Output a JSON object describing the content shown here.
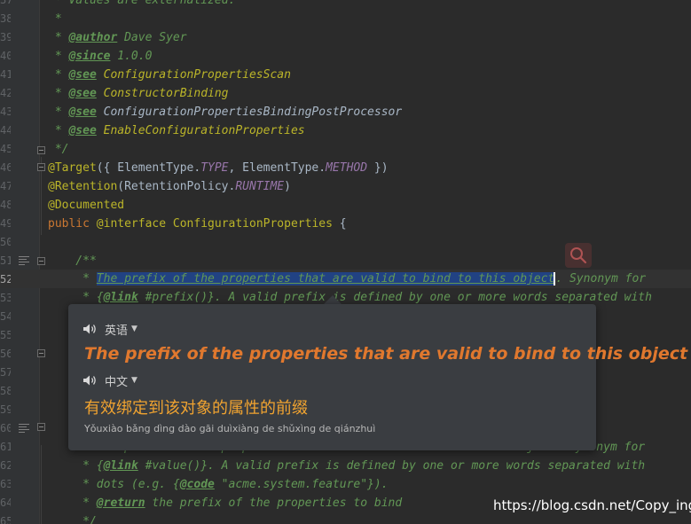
{
  "gutter": {
    "line_numbers": [
      "37",
      "38",
      "39",
      "40",
      "41",
      "42",
      "43",
      "44",
      "45",
      "46",
      "47",
      "48",
      "49",
      "50",
      "51",
      "52",
      "53",
      "54",
      "55",
      "56",
      "57",
      "58",
      "59",
      "60",
      "61",
      "62",
      "63",
      "64",
      "65"
    ],
    "current_line": "52"
  },
  "code": {
    "l37": " * Values are externalized.",
    "l38": " *",
    "l39_tag": "@author",
    "l39_rest": " Dave Syer",
    "l40_tag": "@since",
    "l40_rest": " 1.0.0",
    "l41_tag": "@see",
    "l41_rest": "ConfigurationPropertiesScan",
    "l42_tag": "@see",
    "l42_rest": "ConstructorBinding",
    "l43_tag": "@see",
    "l43_rest": " ConfigurationPropertiesBindingPostProcessor",
    "l44_tag": "@see",
    "l44_rest": "EnableConfigurationProperties",
    "l45": " */",
    "l46_ann": "@Target",
    "l46_a": "({ ElementType.",
    "l46_c1": "TYPE",
    "l46_b": ", ElementType.",
    "l46_c2": "METHOD",
    "l46_end": " })",
    "l47_ann": "@Retention",
    "l47_a": "(RetentionPolicy.",
    "l47_c": "RUNTIME",
    "l47_end": ")",
    "l48_ann": "@Documented",
    "l49_kw": "public",
    "l49_ann": "@interface",
    "l49_name": "ConfigurationProperties",
    "l49_end": " {",
    "l51": "    /**",
    "l52_pre": "     * ",
    "l52_sel": "The prefix of the properties that are valid to bind to this object",
    "l52_post": ". Synonym for",
    "l53_pre": "     * {",
    "l53_tag": "@link",
    "l53_post": " #prefix()}. A valid prefix is defined by one or more words separated with",
    "l61": "     * The prefix of the properties that are valid to bind to this object. Synonym for",
    "l62_pre": "     * {",
    "l62_tag": "@link",
    "l62_post": " #value()}. A valid prefix is defined by one or more words separated with",
    "l63_pre": "     * dots (e.g. {",
    "l63_tag": "@code",
    "l63_post": " \"acme.system.feature\"}).",
    "l64_pre": "     * ",
    "l64_tag": "@return",
    "l64_post": " the prefix of the properties to bind",
    "l65": "     */"
  },
  "translate_popup": {
    "source_lang": "英语",
    "source_text": "The prefix of the properties that are valid to bind to this object",
    "target_lang": "中文",
    "target_text": "有效绑定到该对象的属性的前缀",
    "pinyin": "Yǒuxiào bǎng dìng dào gāi duìxiàng de shǔxìng de qiánzhuì"
  },
  "watermark": "https://blog.csdn.net/Copy_ing",
  "icons": [
    "search-icon",
    "speaker-icon",
    "dropdown-caret-icon",
    "fold-marker-icon",
    "doc-comment-icon"
  ],
  "colors": {
    "editor_bg": "#2b2b2b",
    "comment": "#629755",
    "annotation": "#bbb529",
    "keyword": "#cc7832",
    "constant": "#9876aa",
    "selection": "#214283",
    "popup_bg": "#3a3d41",
    "source_text": "#e0782e",
    "target_text": "#f0a330"
  }
}
